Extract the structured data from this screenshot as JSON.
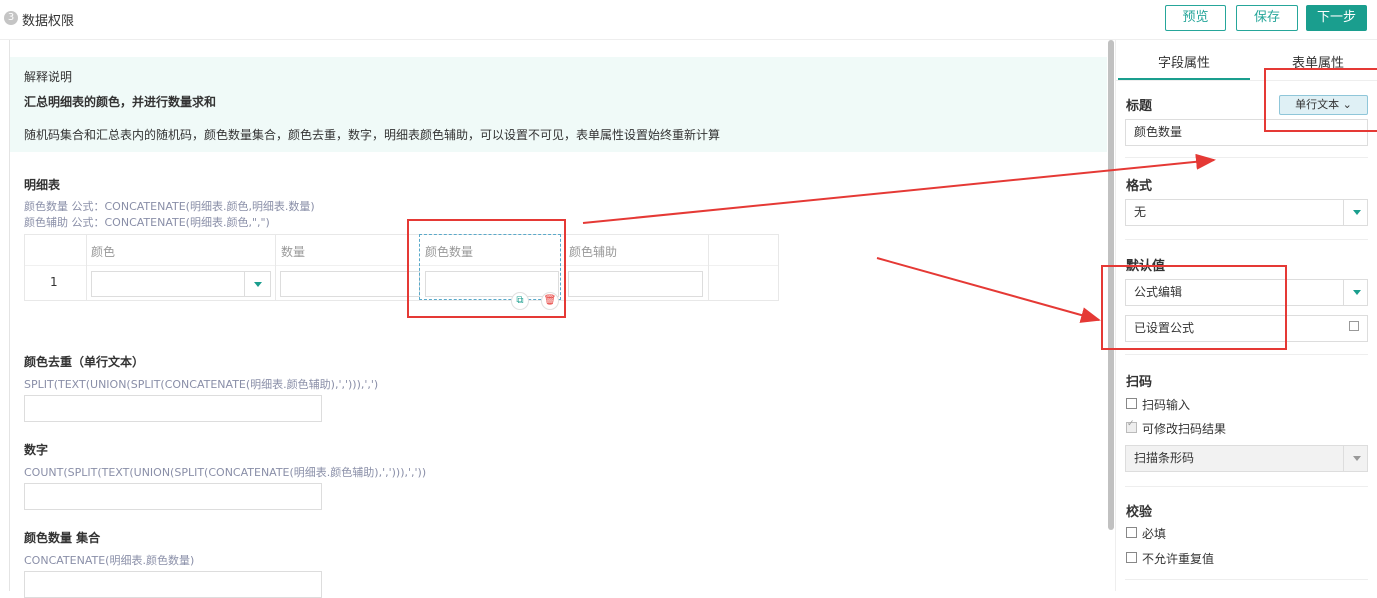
{
  "header": {
    "step_number": "3",
    "step_title": "数据权限",
    "btn_preview": "预览",
    "btn_save": "保存",
    "btn_next": "下一步"
  },
  "explain": {
    "title": "解释说明",
    "headline": "汇总明细表的颜色，并进行数量求和",
    "text": "随机码集合和汇总表内的随机码，颜色数量集合，颜色去重，数字，明细表颜色辅助，可以设置不可见，表单属性设置始终重新计算"
  },
  "detail_table": {
    "label": "明细表",
    "formula1": "颜色数量 公式：CONCATENATE(明细表.颜色,明细表.数量)",
    "formula2": "颜色辅助 公式：CONCATENATE(明细表.颜色,\",\")",
    "columns": [
      "颜色",
      "数量",
      "颜色数量",
      "颜色辅助"
    ],
    "row_number": "1"
  },
  "fields": [
    {
      "label": "颜色去重（单行文本）",
      "formula": "SPLIT(TEXT(UNION(SPLIT(CONCATENATE(明细表.颜色辅助),','))),',')"
    },
    {
      "label": "数字",
      "formula": "COUNT(SPLIT(TEXT(UNION(SPLIT(CONCATENATE(明细表.颜色辅助),','))),','))"
    },
    {
      "label": "颜色数量 集合",
      "formula": "CONCATENATE(明细表.颜色数量)"
    }
  ],
  "panel": {
    "tab_field": "字段属性",
    "tab_form": "表单属性",
    "title_label": "标题",
    "type_chip": "单行文本",
    "title_value": "颜色数量",
    "format_label": "格式",
    "format_value": "无",
    "default_label": "默认值",
    "default_value": "公式编辑",
    "formula_status": "已设置公式",
    "scan_label": "扫码",
    "scan_input": "扫码输入",
    "scan_modify": "可修改扫码结果",
    "scan_type": "扫描条形码",
    "validate_label": "校验",
    "required": "必填",
    "no_duplicate": "不允许重复值"
  },
  "colors": {
    "accent": "#1a9e8e",
    "annotation": "#e53935",
    "explain_bg": "#f0faf8"
  }
}
